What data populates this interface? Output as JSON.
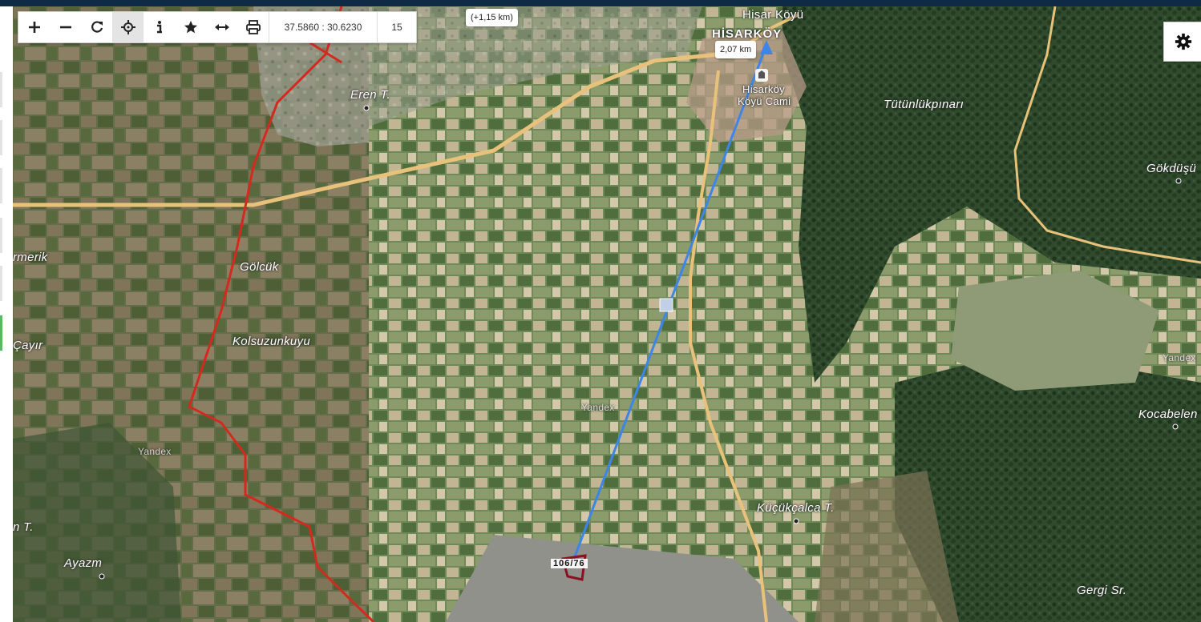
{
  "toolbar": {
    "buttons": [
      {
        "name": "zoom-in-button",
        "icon": "plus-icon",
        "active": false
      },
      {
        "name": "zoom-out-button",
        "icon": "minus-icon",
        "active": false
      },
      {
        "name": "refresh-button",
        "icon": "refresh-icon",
        "active": false
      },
      {
        "name": "locate-button",
        "icon": "crosshair-icon",
        "active": true
      },
      {
        "name": "info-button",
        "icon": "info-icon",
        "active": false
      },
      {
        "name": "favorite-button",
        "icon": "star-icon",
        "active": false
      },
      {
        "name": "measure-button",
        "icon": "horizontal-arrows-icon",
        "active": false
      },
      {
        "name": "print-button",
        "icon": "printer-icon",
        "active": false
      }
    ],
    "coordinates": "37.5860 : 30.6230",
    "zoom_level": "15"
  },
  "settings": {
    "icon": "gear-icon"
  },
  "measurement": {
    "distance_label": "2,07 km",
    "extra_distance_label": "(+1,15 km)",
    "color": "#3d85e8"
  },
  "parcel": {
    "label": "106/76",
    "color": "#8b1020"
  },
  "boundary": {
    "color": "#d42a1e"
  },
  "roads": {
    "color": "#e8c27a"
  },
  "places": [
    {
      "name": "place-hisar-koyu",
      "text": "Hisar Köyü"
    },
    {
      "name": "place-hisarkoy",
      "text": "HİSARKÖY"
    },
    {
      "name": "place-hisarkoy-mosque-1",
      "text": "Hisarköy"
    },
    {
      "name": "place-hisarkoy-mosque-2",
      "text": "Köyü Cami"
    },
    {
      "name": "place-eren",
      "text": "Eren T."
    },
    {
      "name": "place-tutunlukpinari",
      "text": "Tütünlükpınarı"
    },
    {
      "name": "place-gokdus",
      "text": "Gökdüşü"
    },
    {
      "name": "place-germerik",
      "text": "rmerik"
    },
    {
      "name": "place-golcuk",
      "text": "Gölcük"
    },
    {
      "name": "place-kolsuzunkuyu",
      "text": "Kolsuzunkuyu"
    },
    {
      "name": "place-cayir",
      "text": "Çayır"
    },
    {
      "name": "place-yandex-left",
      "text": "Yandex"
    },
    {
      "name": "place-yandex-mid",
      "text": "Yandex"
    },
    {
      "name": "place-kocabelen",
      "text": "Kocabelen"
    },
    {
      "name": "place-kucukcalca",
      "text": "Küçükçalca T."
    },
    {
      "name": "place-n-t",
      "text": "n T."
    },
    {
      "name": "place-ayazm",
      "text": "Ayazm"
    },
    {
      "name": "place-gergi",
      "text": "Gergi Sr."
    },
    {
      "name": "place-yandex-right",
      "text": "Yandex"
    }
  ]
}
